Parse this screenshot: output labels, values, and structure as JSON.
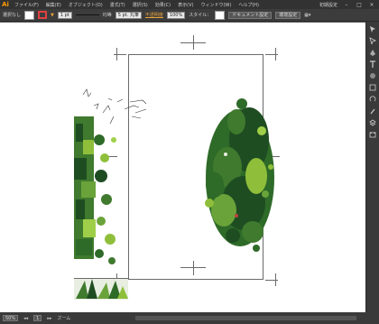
{
  "app": {
    "logo": "Ai"
  },
  "menu": [
    "ファイル(F)",
    "編集(E)",
    "オブジェクト(O)",
    "書式(T)",
    "選択(S)",
    "効果(C)",
    "表示(V)",
    "ウィンドウ(W)",
    "ヘルプ(H)"
  ],
  "workspace": {
    "label": "初期設定"
  },
  "window_controls": {
    "minimize": "–",
    "maximize": "□",
    "close": "×"
  },
  "control": {
    "selection_status": "選択なし",
    "stroke_weight": "1 pt",
    "stroke_profile_label": "均等",
    "brush_label": "5 pt. 丸筆",
    "opacity_link": "不透明度",
    "opacity_value": "100%",
    "style_label": "スタイル：",
    "doc_setup_button": "ドキュメント設定",
    "prefs_button": "環境設定"
  },
  "status": {
    "zoom": "50%",
    "page": "1",
    "tool_name": "ズーム"
  },
  "colors": {
    "ui_dark": "#323232",
    "ui_mid": "#3c3c3c",
    "canvas": "#ffffff",
    "accent": "#e8a23a",
    "leaf_dark": "#1f4d22",
    "leaf_mid": "#3f7a2e",
    "leaf_light": "#8fbf3a"
  },
  "tools": [
    "selection-tool-icon",
    "direct-selection-tool-icon",
    "pen-tool-icon",
    "type-tool-icon",
    "brush-tool-icon",
    "shape-tool-icon",
    "rotate-tool-icon",
    "eyedropper-tool-icon",
    "layers-panel-icon",
    "artboard-tool-icon"
  ]
}
